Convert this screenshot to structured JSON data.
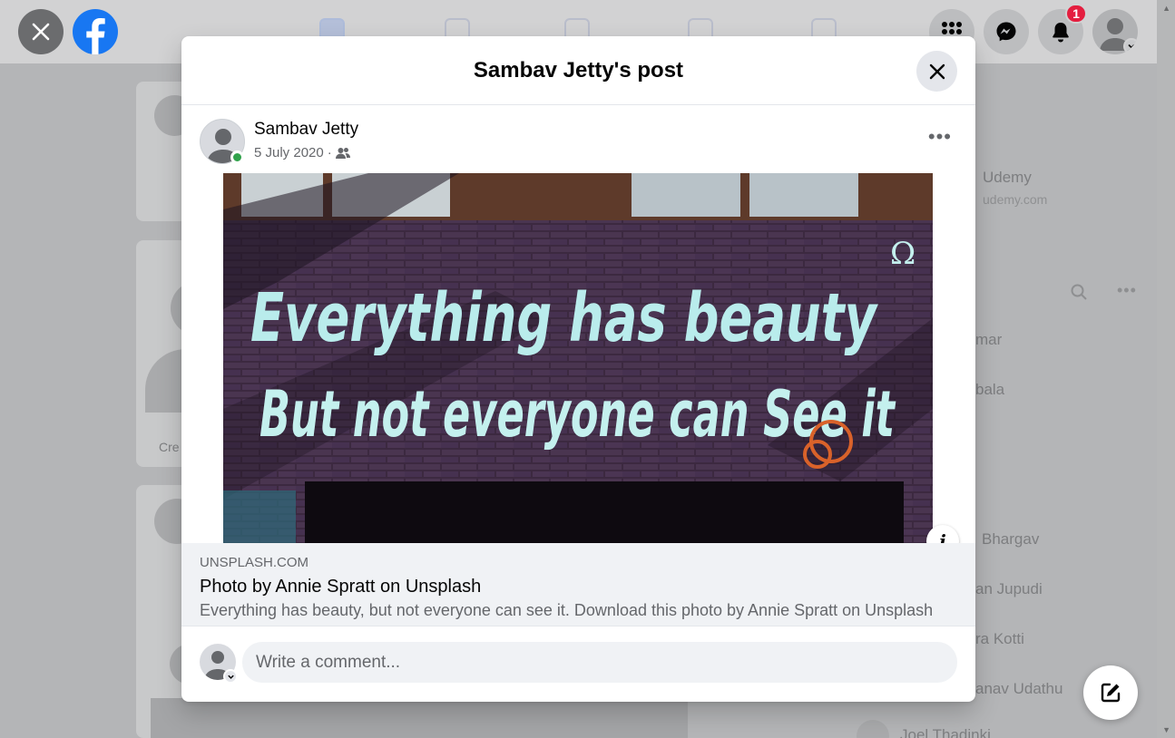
{
  "topbar": {
    "close_icon": "close-icon",
    "logo": "facebook-logo",
    "nav_icons": [
      "home-icon",
      "friends-icon",
      "watch-icon",
      "marketplace-icon",
      "gaming-icon"
    ],
    "menu_icon": "grid-menu-icon",
    "messenger_icon": "messenger-icon",
    "notifications_icon": "bell-icon",
    "notifications_count": "1",
    "account_icon": "avatar"
  },
  "background": {
    "sponsor_name": "Udemy",
    "sponsor_url": "udemy.com",
    "create_story_label": "Cre",
    "contacts": [
      "mar",
      "bala",
      "Bhargav",
      "an Jupudi",
      "ra Kotti",
      "anav Udathu",
      "Joel Thadinki"
    ]
  },
  "modal": {
    "title": "Sambav Jetty's post",
    "close_icon": "close-icon",
    "post": {
      "author": "Sambav Jetty",
      "date": "5 July 2020",
      "separator": "·",
      "audience_icon": "friends-icon",
      "more_label": "•••",
      "image_alt": "Graffiti on a brick wall reading: Everything has beauty But not everyone can see it",
      "graffiti_line1": "Everything has beauty",
      "graffiti_line2": "But not everyone can See it",
      "info_label": "i"
    },
    "link": {
      "domain": "UNSPLASH.COM",
      "title": "Photo by Annie Spratt on Unsplash",
      "description": "Everything has beauty, but not everyone can see it. Download this photo by Annie Spratt on Unsplash"
    },
    "comment": {
      "placeholder": "Write a comment..."
    }
  },
  "compose_icon": "compose-icon",
  "colors": {
    "brand": "#1877f2",
    "badge": "#e41e3f",
    "online": "#31a24c"
  }
}
